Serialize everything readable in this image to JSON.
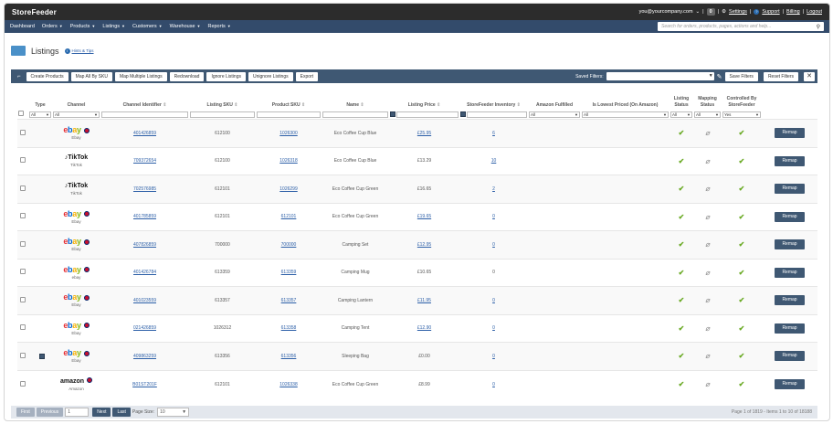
{
  "app": {
    "brand": "StoreFeeder",
    "user": "you@yourcompany.com",
    "user_caret": "⌄",
    "sep": "|",
    "notif_count": "0",
    "settings": "Settings",
    "support": "Support",
    "billing": "Billing",
    "logout": "Logout"
  },
  "nav": [
    {
      "label": "Dashboard",
      "caret": ""
    },
    {
      "label": "Orders",
      "caret": "▼"
    },
    {
      "label": "Products",
      "caret": "▼"
    },
    {
      "label": "Listings",
      "caret": "▼"
    },
    {
      "label": "Customers",
      "caret": "▼"
    },
    {
      "label": "Warehouse",
      "caret": "▼"
    },
    {
      "label": "Reports",
      "caret": "▼"
    }
  ],
  "search": {
    "placeholder": "Search for orders, products, pages, actions and help...",
    "icon": "search-icon"
  },
  "page": {
    "title": "Listings",
    "tips": "Hints & Tips"
  },
  "toolbar": {
    "buttons": [
      "Create Products",
      "Map All By SKU",
      "Map Multiple Listings",
      "Redownload",
      "Ignore Listings",
      "Unignore Listings",
      "Export"
    ],
    "saved_filters_label": "Saved Filters:",
    "save_filters": "Save Filters",
    "reset_filters": "Reset Filters"
  },
  "columns": {
    "type": "Type",
    "channel": "Channel",
    "channel_identifier": "Channel Identifier",
    "listing_sku": "Listing SKU",
    "product_sku": "Product SKU",
    "name": "Name",
    "listing_price": "Listing Price",
    "sf_inventory": "StoreFeeder Inventory",
    "amazon_fulfilled": "Amazon Fulfilled",
    "lowest_priced": "Is Lowest Priced (On Amazon)",
    "listing_status": "Listing Status",
    "mapping_status": "Mapping Status",
    "controlled_by": "Controlled By StoreFeeder",
    "sort_glyph": "⇕"
  },
  "filters": {
    "all": "All",
    "yes": "Yes",
    "caret": "▼"
  },
  "rows": [
    {
      "channel_logo": "ebay",
      "channel": "Ebay",
      "channel_id": "401426859",
      "listing_sku": "612100",
      "product_sku": "1026300",
      "name": "Eco Coffee Cup Blue",
      "price": "£25.95",
      "price_link": true,
      "inventory": "6",
      "expand": false
    },
    {
      "channel_logo": "tiktok",
      "channel": "TikTok",
      "channel_id": "709372654",
      "listing_sku": "612100",
      "product_sku": "1026318",
      "name": "Eco Coffee Cup Blue",
      "price": "£13.29",
      "price_link": false,
      "inventory": "10",
      "expand": false
    },
    {
      "channel_logo": "tiktok",
      "channel": "TikTok",
      "channel_id": "702576985",
      "listing_sku": "612101",
      "product_sku": "1026299",
      "name": "Eco Coffee Cup Green",
      "price": "£16.65",
      "price_link": false,
      "inventory": "2",
      "expand": false
    },
    {
      "channel_logo": "ebay",
      "channel": "Ebay",
      "channel_id": "401785859",
      "listing_sku": "612101",
      "product_sku": "612101",
      "name": "Eco Coffee Cup Green",
      "price": "£19.65",
      "price_link": true,
      "inventory": "0",
      "expand": false
    },
    {
      "channel_logo": "ebay",
      "channel": "Ebay",
      "channel_id": "407826859",
      "listing_sku": "700000",
      "product_sku": "700000",
      "name": "Camping Set",
      "price": "£12.95",
      "price_link": true,
      "inventory": "0",
      "expand": false
    },
    {
      "channel_logo": "ebay",
      "channel": "ebay",
      "channel_id": "401426784",
      "listing_sku": "613359",
      "product_sku": "613359",
      "name": "Camping Mug",
      "price": "£10.65",
      "price_link": false,
      "inventory": "0",
      "expand": false
    },
    {
      "channel_logo": "ebay",
      "channel": "Ebay",
      "channel_id": "401023559",
      "listing_sku": "613357",
      "product_sku": "613357",
      "name": "Camping Lantern",
      "price": "£11.95",
      "price_link": true,
      "inventory": "0",
      "expand": false
    },
    {
      "channel_logo": "ebay",
      "channel": "Ebay",
      "channel_id": "021426859",
      "listing_sku": "1026312",
      "product_sku": "613358",
      "name": "Camping Tent",
      "price": "£12.90",
      "price_link": true,
      "inventory": "0",
      "expand": false
    },
    {
      "channel_logo": "ebay",
      "channel": "Ebay",
      "channel_id": "409863259",
      "listing_sku": "613356",
      "product_sku": "613356",
      "name": "Sleeping Bag",
      "price": "£0.00",
      "price_link": false,
      "inventory": "0",
      "expand": true
    },
    {
      "channel_logo": "amazon",
      "channel": "Amazon",
      "channel_id": "B01ST201F",
      "listing_sku": "612101",
      "product_sku": "1026338",
      "name": "Eco Coffee Cup Green",
      "price": "£8.99",
      "price_link": false,
      "inventory": "0",
      "expand": false
    }
  ],
  "row_actions": {
    "remap": "Remap"
  },
  "status_colors": {
    "active": "#6aaa24",
    "mapping": "#8a8a8a",
    "accent": "#3f5873"
  },
  "logos": {
    "ebay": [
      "e",
      "b",
      "a",
      "y"
    ],
    "tiktok": "TikTok",
    "amazon": "amazon"
  },
  "icons": {
    "check": "✔",
    "clip": "⌀",
    "gear": "⚙",
    "help": "?",
    "edit": "✎",
    "close": "✕",
    "scroll": "⌐"
  },
  "pager": {
    "first": "First",
    "previous": "Previous",
    "page_value": "1",
    "next": "Next",
    "last": "Last",
    "page_size_label": "Page Size:",
    "page_size": "10",
    "info": "Page 1 of 1819 - Items 1 to 10 of 18188"
  }
}
